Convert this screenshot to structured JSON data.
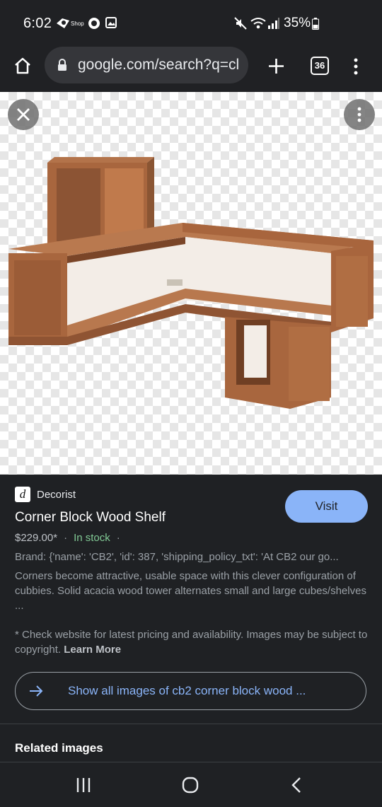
{
  "status_bar": {
    "time": "6:02",
    "battery": "35%",
    "icons": [
      "spotify-icon",
      "shop-icon",
      "circle-icon",
      "image-icon",
      "mute-icon",
      "wifi-icon",
      "signal-icon",
      "battery-icon"
    ]
  },
  "browser": {
    "url": "google.com/search?q=cl",
    "tab_count": "36",
    "icons": [
      "home-icon",
      "lock-icon",
      "plus-icon",
      "more-vert-icon"
    ]
  },
  "viewer": {
    "close_icon": "close-icon",
    "menu_icon": "more-vert-icon",
    "image_alt": "corner block wood shelf"
  },
  "result": {
    "source": "Decorist",
    "title": "Corner Block Wood Shelf",
    "visit_label": "Visit",
    "price": "$229.00*",
    "stock": "In stock",
    "brand": "Brand: {'name': 'CB2', 'id': 387, 'shipping_policy_txt': 'At CB2 our go...",
    "description": "Corners become attractive, usable space with this clever configuration of cubbies. Solid acacia wood tower alternates small and large cubes/shelves ...",
    "disclaimer": "* Check website for latest pricing and availability. Images may be subject to copyright.",
    "learn_more": "Learn More",
    "show_all": "Show all images of cb2 corner block wood ...",
    "related": "Related images"
  },
  "colors": {
    "accent": "#8ab4f8",
    "stock": "#81c995",
    "background": "#1f2124"
  }
}
